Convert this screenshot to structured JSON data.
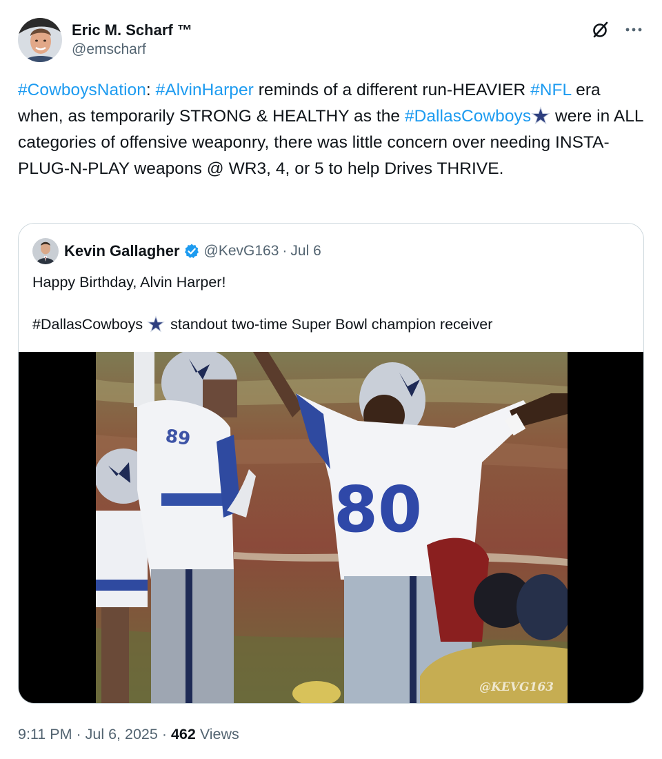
{
  "author": {
    "display_name": "Eric M. Scharf ™",
    "handle": "@emscharf"
  },
  "body": {
    "segments": [
      {
        "text": "#CowboysNation",
        "link": true
      },
      {
        "text": ": ",
        "link": false
      },
      {
        "text": "#AlvinHarper",
        "link": true
      },
      {
        "text": " reminds of a different run-HEAVIER ",
        "link": false
      },
      {
        "text": "#NFL",
        "link": true
      },
      {
        "text": " era when, as temporarily STRONG & HEALTHY as the ",
        "link": false
      },
      {
        "text": "#DallasCowboys",
        "link": true
      },
      {
        "text": "star-emoji",
        "emoji": true
      },
      {
        "text": " were in ALL categories of offensive weaponry, there was little concern over needing INSTA-PLUG-N-PLAY weapons @ WR3, 4, or 5 to help Drives THRIVE.",
        "link": false
      }
    ]
  },
  "quote": {
    "display_name": "Kevin Gallagher",
    "handle": "@KevG163",
    "separator": "·",
    "date": "Jul 6",
    "line1": "Happy Birthday, Alvin Harper!",
    "line2_tag": "#DallasCowboys",
    "line2_rest": "standout two-time Super Bowl champion receiver",
    "watermark": "@KEVG163"
  },
  "footer": {
    "time": "9:11 PM",
    "sep1": "·",
    "date": "Jul 6, 2025",
    "sep2": "·",
    "views_count": "462",
    "views_label": "Views"
  },
  "colors": {
    "link": "#1d9bf0",
    "secondary_text": "#536471",
    "border": "#cfd9de",
    "verified": "#1d9bf0",
    "star": "#2e3f7f"
  }
}
